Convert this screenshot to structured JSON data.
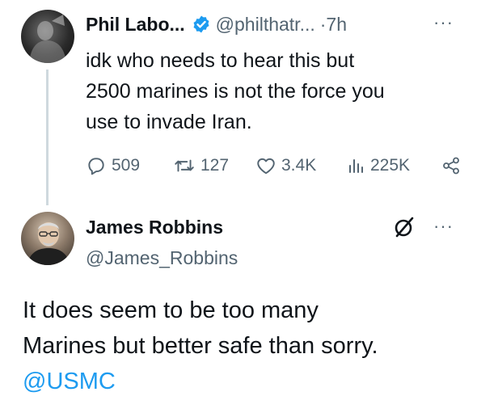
{
  "original_tweet": {
    "author_name": "Phil Labo...",
    "handle": "@philthatr...",
    "separator": "·",
    "time": "7h",
    "more": "···",
    "text_lines": [
      "idk who needs to hear this but",
      "2500 marines is not the force you",
      "use to invade Iran."
    ],
    "stats": {
      "replies": "509",
      "reposts": "127",
      "likes": "3.4K",
      "views": "225K"
    }
  },
  "reply_tweet": {
    "author_name": "James Robbins",
    "handle": "@James_Robbins",
    "more": "···",
    "text_lines": [
      "It does seem to be too many",
      "Marines but better safe than sorry."
    ],
    "mention": "@USMC"
  },
  "colors": {
    "text": "#0f1419",
    "secondary": "#536471",
    "link": "#1d9bf0",
    "thread_line": "#cfd9de"
  }
}
